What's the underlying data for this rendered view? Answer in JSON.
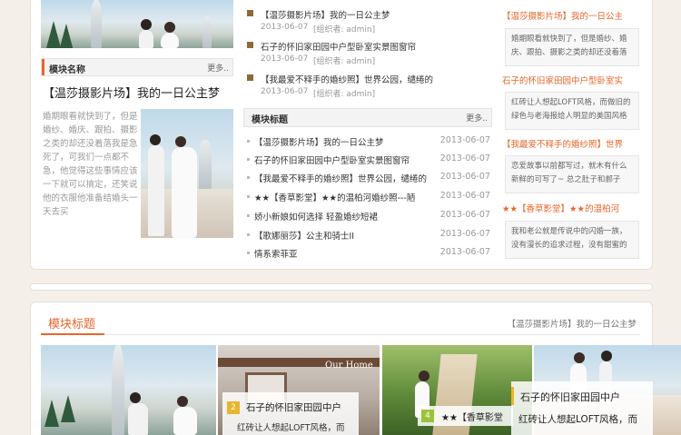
{
  "left": {
    "module_name": "模块名称",
    "more": "更多..",
    "feature_title": "【温莎摄影片场】我的一日公主梦",
    "feature_text": "婚期眼看就快到了，但是婚纱、婚庆、跟拍、摄影之类的却还没着落我是急死了，可我们一点都不急，他觉得这些事情应该一下就可以搞定，还笑说他的衣服他准备结婚头一天去买"
  },
  "middle": {
    "news": [
      {
        "title": "【温莎摄影片场】我的一日公主梦",
        "date": "2013-06-07",
        "author": "[组织者: admin]"
      },
      {
        "title": "石子的怀旧家田园中户型卧室实景图窗帘",
        "date": "2013-06-07",
        "author": "[组织者: admin]"
      },
      {
        "title": "【我最爱不释手的婚纱照】世界公园，缱绻的",
        "date": "2013-06-07",
        "author": "[组织者: admin]"
      }
    ],
    "module_title": "模块标题",
    "more": "更多..",
    "list": [
      {
        "title": "【温莎摄影片场】我的一日公主梦",
        "date": "2013-06-07"
      },
      {
        "title": "石子的怀旧家田园中户型卧室实景图窗帘",
        "date": "2013-06-07"
      },
      {
        "title": "【我最爱不释手的婚纱照】世界公园，缱绻的",
        "date": "2013-06-07"
      },
      {
        "title": "★★【香草影堂】★★的温柏河婚纱照---陋",
        "date": "2013-06-07"
      },
      {
        "title": "娇小新娘如何选择 轻盈婚纱短裙",
        "date": "2013-06-07"
      },
      {
        "title": "【歌娜丽莎】公主和骑士II",
        "date": "2013-06-07"
      },
      {
        "title": "情系索菲亚",
        "date": "2013-06-07"
      }
    ]
  },
  "right": {
    "items": [
      {
        "title": "【温莎摄影片场】我的一日公主",
        "text": "婚期眼看就快到了，但是婚纱、婚庆、跟拍、摄影之类的却还没着落"
      },
      {
        "title": "石子的怀旧家田园中户型卧室实",
        "text": "红砖让人想起LOFT风格，而做旧的绿色与老海报给人明显的美国风格"
      },
      {
        "title": "【我最爱不释手的婚纱照】世界",
        "text": "恋爱故事以前都写过，就木有什么新鲜的可写了~ 总之肚子和郝子"
      },
      {
        "title": "★★【香草影堂】★★的温柏河",
        "text": "我和老公就是传说中的闪婚一族，没有漫长的追求过程，没有甜蜜的"
      }
    ]
  },
  "bottom": {
    "module_title": "模块标题",
    "right_link": "【温莎摄影片场】我的一日公主梦",
    "slides": [
      {
        "num": "2",
        "title": "石子的怀旧家田园中户",
        "text": "红砖让人想起LOFT风格，而",
        "num_color": "#e8b62a"
      },
      {
        "num": "4",
        "title": "★★【香草影堂",
        "text": "",
        "num_color": "#9ac23a"
      },
      {
        "num": "",
        "title": "石子的怀旧家田园中户",
        "text": "红砖让人想起LOFT风格，而",
        "num_color": "#e8b62a"
      }
    ],
    "sign_text": "Our Home"
  },
  "colors": {
    "accent": "#e8662a",
    "muted": "#999999"
  }
}
